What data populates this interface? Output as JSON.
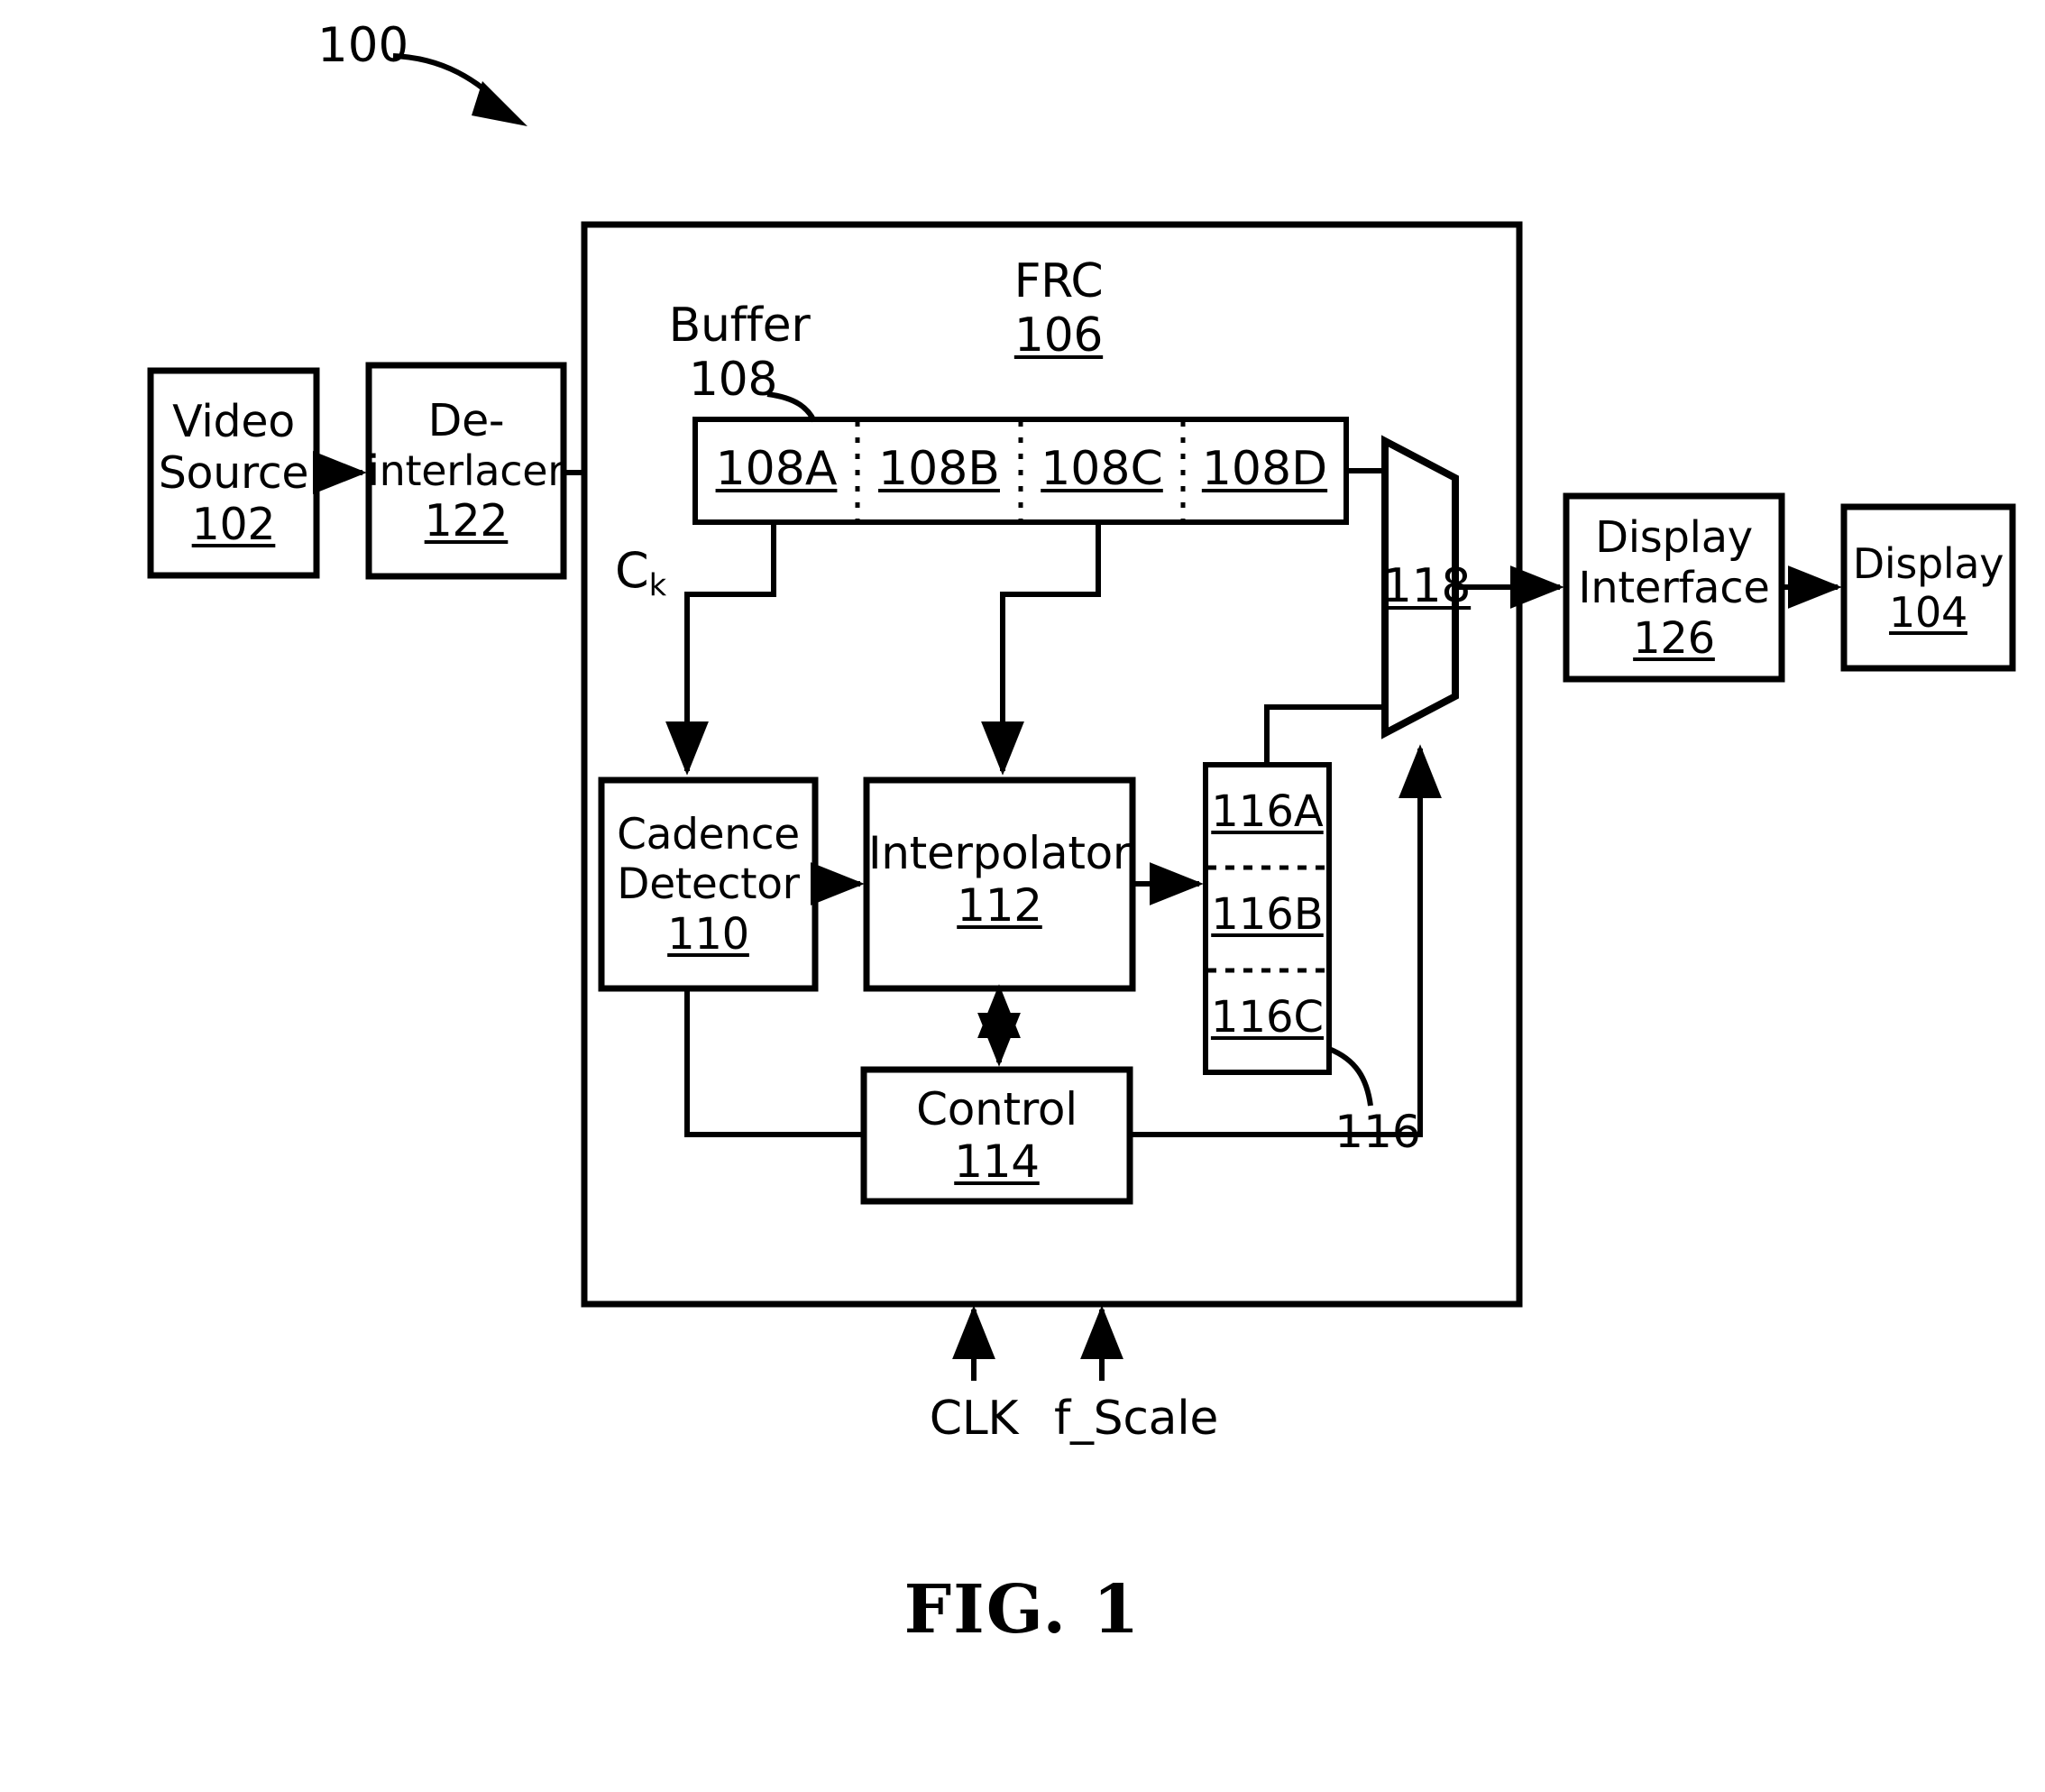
{
  "figure": {
    "caption": "FIG. 1",
    "system_ref": "100"
  },
  "blocks": {
    "video_source": {
      "line1": "Video",
      "line2": "Source",
      "ref": "102"
    },
    "deinterlacer": {
      "line1": "De-",
      "line2": "interlacer",
      "ref": "122"
    },
    "frc": {
      "title": "FRC",
      "ref": "106"
    },
    "buffer": {
      "title": "Buffer",
      "ref": "108"
    },
    "buffer_cells": [
      "108A",
      "108B",
      "108C",
      "108D"
    ],
    "cadence_detector": {
      "line1": "Cadence",
      "line2": "Detector",
      "ref": "110"
    },
    "interpolator": {
      "title": "Interpolator",
      "ref": "112"
    },
    "control": {
      "title": "Control",
      "ref": "114"
    },
    "frame_store": {
      "cells": [
        "116A",
        "116B",
        "116C"
      ],
      "ref": "116"
    },
    "mux": {
      "ref": "118"
    },
    "display_interface": {
      "line1": "Display",
      "line2": "Interface",
      "ref": "126"
    },
    "display": {
      "title": "Display",
      "ref": "104"
    }
  },
  "signals": {
    "ck_label": "C",
    "ck_subscript": "k",
    "clk": "CLK",
    "f_scale": "f_Scale"
  },
  "style": {
    "line_color": "#000000",
    "fill_color": "#ffffff"
  }
}
